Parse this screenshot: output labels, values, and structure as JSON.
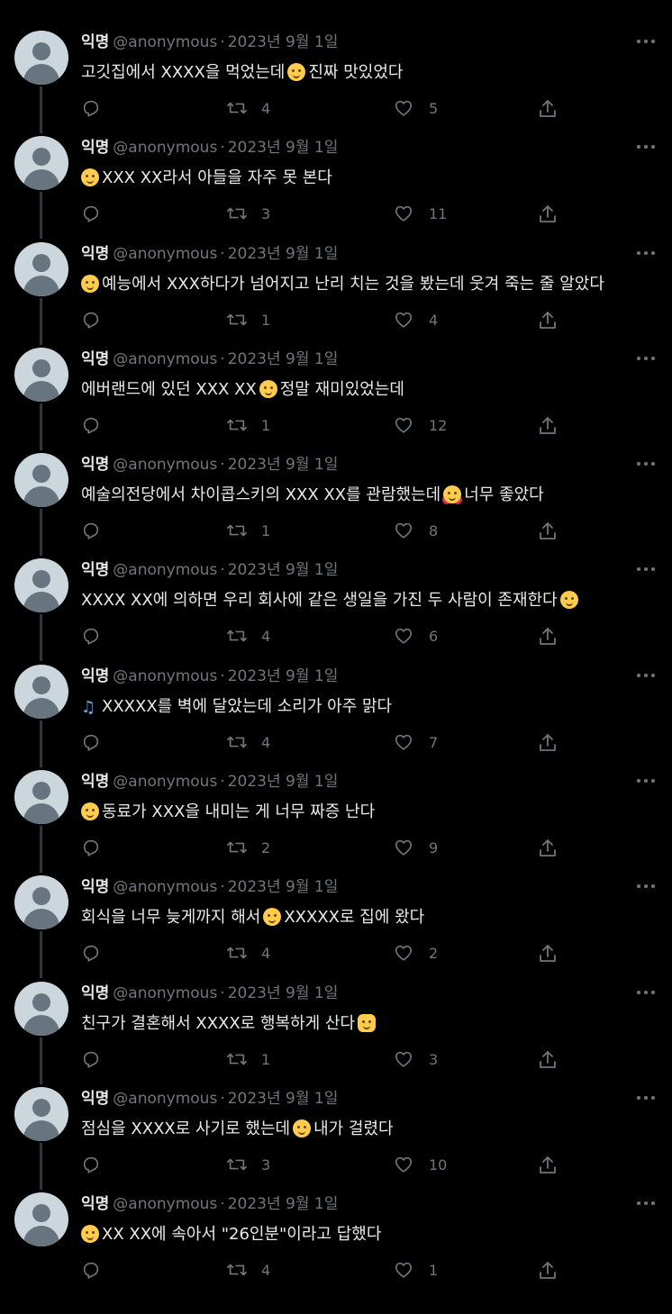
{
  "tweets": [
    {
      "name": "익명",
      "handle": "@anonymous",
      "date": "2023년 9월 1일",
      "text_before": "고깃집에서 XXXX을 먹었는데",
      "emoji": "yum-emoji",
      "text_after": "진짜 맛있었다",
      "replies": "",
      "retweets": "4",
      "likes": "5"
    },
    {
      "name": "익명",
      "handle": "@anonymous",
      "date": "2023년 9월 1일",
      "text_before": "",
      "emoji": "crying-face-emoji",
      "text_after": "XXX XX라서 아들을 자주 못 본다",
      "replies": "",
      "retweets": "3",
      "likes": "11"
    },
    {
      "name": "익명",
      "handle": "@anonymous",
      "date": "2023년 9월 1일",
      "text_before": "",
      "emoji": "rofl-emoji",
      "text_after": "예능에서 XXX하다가 넘어지고 난리 치는 것을 봤는데 웃겨 죽는 줄 알았다",
      "replies": "",
      "retweets": "1",
      "likes": "4"
    },
    {
      "name": "익명",
      "handle": "@anonymous",
      "date": "2023년 9월 1일",
      "text_before": "에버랜드에 있던 XXX XX",
      "emoji": "slightly-frowning-emoji",
      "text_after": "정말 재미있었는데",
      "replies": "",
      "retweets": "1",
      "likes": "12"
    },
    {
      "name": "익명",
      "handle": "@anonymous",
      "date": "2023년 9월 1일",
      "text_before": "예술의전당에서 차이콥스키의 XXX XX를 관람했는데",
      "emoji": "smiling-hearts-emoji",
      "text_after": "너무 좋았다",
      "replies": "",
      "retweets": "1",
      "likes": "8"
    },
    {
      "name": "익명",
      "handle": "@anonymous",
      "date": "2023년 9월 1일",
      "text_before": "XXXX XX에 의하면 우리 회사에 같은 생일을 가진 두 사람이 존재한다",
      "emoji": "thinking-emoji",
      "text_after": "",
      "replies": "",
      "retweets": "4",
      "likes": "6"
    },
    {
      "name": "익명",
      "handle": "@anonymous",
      "date": "2023년 9월 1일",
      "text_before": "",
      "emoji": "music-note-emoji",
      "text_after": "XXXXX를 벽에 달았는데 소리가 아주 맑다",
      "replies": "",
      "retweets": "4",
      "likes": "7"
    },
    {
      "name": "익명",
      "handle": "@anonymous",
      "date": "2023년 9월 1일",
      "text_before": "",
      "emoji": "angry-emoji",
      "text_after": "동료가 XXX을 내미는 게 너무 짜증 난다",
      "replies": "",
      "retweets": "2",
      "likes": "9"
    },
    {
      "name": "익명",
      "handle": "@anonymous",
      "date": "2023년 9월 1일",
      "text_before": "회식을 너무 늦게까지 해서",
      "emoji": "sleepy-emoji",
      "text_after": "XXXXX로 집에 왔다",
      "replies": "",
      "retweets": "4",
      "likes": "2"
    },
    {
      "name": "익명",
      "handle": "@anonymous",
      "date": "2023년 9월 1일",
      "text_before": "친구가 결혼해서 XXXX로 행복하게 산다",
      "emoji": "clapping-emoji",
      "text_after": "",
      "replies": "",
      "retweets": "1",
      "likes": "3"
    },
    {
      "name": "익명",
      "handle": "@anonymous",
      "date": "2023년 9월 1일",
      "text_before": "점심을 XXXX로 사기로 했는데",
      "emoji": "loudly-crying-emoji",
      "text_after": "내가 걸렸다",
      "replies": "",
      "retweets": "3",
      "likes": "10"
    },
    {
      "name": "익명",
      "handle": "@anonymous",
      "date": "2023년 9월 1일",
      "text_before": "",
      "emoji": "persevering-emoji",
      "text_after": "XX XX에 속아서 \"26인분\"이라고 답했다",
      "replies": "",
      "retweets": "4",
      "likes": "1"
    }
  ],
  "separator": "·"
}
